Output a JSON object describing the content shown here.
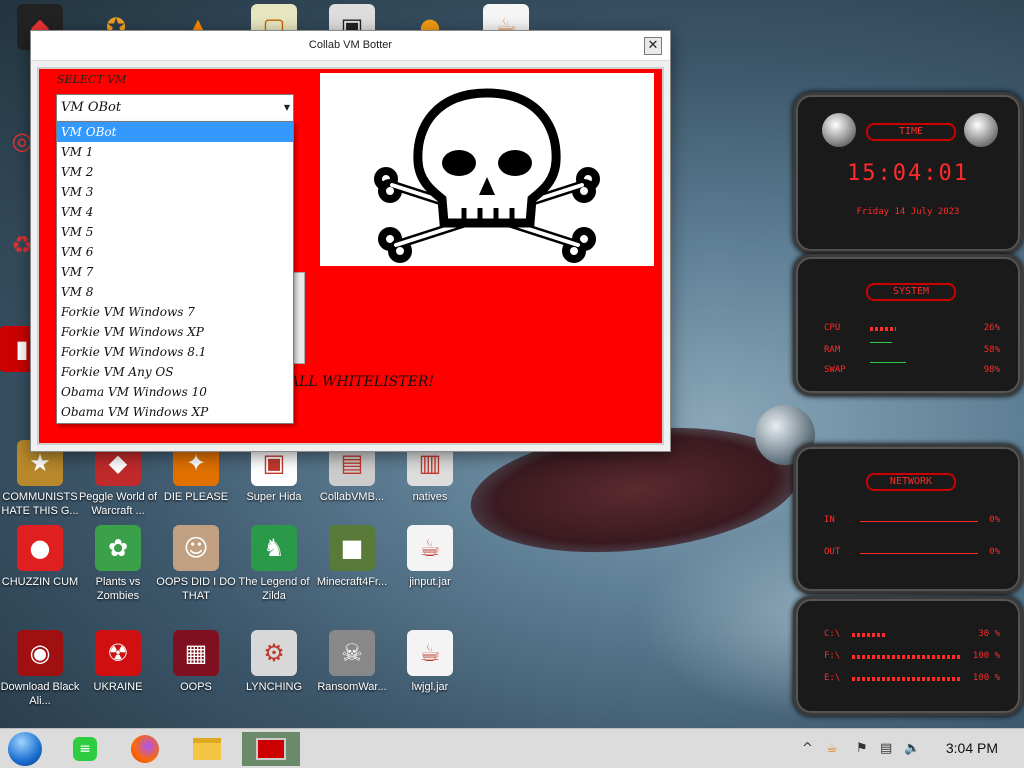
{
  "window": {
    "title": "Collab VM Botter",
    "close_glyph": "✕",
    "select_label": "SELECT VM",
    "selected_vm": "VM OBot",
    "vm_options": [
      "VM OBot",
      "VM 1",
      "VM 2",
      "VM 3",
      "VM 4",
      "VM 5",
      "VM 6",
      "VM 7",
      "VM 8",
      "Forkie VM Windows 7",
      "Forkie VM Windows XP",
      "Forkie VM Windows 8.1",
      "Forkie VM Any OS",
      "Obama VM Windows 10",
      "Obama VM Windows XP"
    ],
    "whitelister_text": "ALL WHITELISTER!",
    "skull_icon": "skull-and-crossbones-icon"
  },
  "desktop_icons": [
    {
      "label": "COMMUNISTS HATE THIS G...",
      "color": "#b8892b",
      "glyph": "★"
    },
    {
      "label": "Peggle World of Warcraft ...",
      "color": "#c02a2a",
      "glyph": "◆"
    },
    {
      "label": "DIE PLEASE",
      "color": "#e07000",
      "glyph": "✦"
    },
    {
      "label": "Super Hida",
      "color": "#ffffff",
      "glyph": "▣"
    },
    {
      "label": "CollabVMB...",
      "color": "#cccccc",
      "glyph": "▤"
    },
    {
      "label": "natives",
      "color": "#dddddd",
      "glyph": "▥"
    },
    {
      "label": "CHUZZIN CUM",
      "color": "#e02020",
      "glyph": "●"
    },
    {
      "label": "Plants vs Zombies",
      "color": "#3aa04a",
      "glyph": "✿"
    },
    {
      "label": "OOPS DID I DO THAT",
      "color": "#c0a080",
      "glyph": "☺"
    },
    {
      "label": "The Legend of Zilda",
      "color": "#2a9a4a",
      "glyph": "♞"
    },
    {
      "label": "Minecraft4Fr...",
      "color": "#5a7a3a",
      "glyph": "■"
    },
    {
      "label": "jinput.jar",
      "color": "#f4f4f4",
      "glyph": "☕"
    },
    {
      "label": "Download Black Ali...",
      "color": "#a01010",
      "glyph": "◉"
    },
    {
      "label": "UKRAINE",
      "color": "#d01010",
      "glyph": "☢"
    },
    {
      "label": "OOPS",
      "color": "#801020",
      "glyph": "▦"
    },
    {
      "label": "LYNCHING",
      "color": "#d8d8d8",
      "glyph": "⚙"
    },
    {
      "label": "RansomWar...",
      "color": "#888888",
      "glyph": "☠"
    },
    {
      "label": "lwjgl.jar",
      "color": "#f4f4f4",
      "glyph": "☕"
    }
  ],
  "gadgets": {
    "time": {
      "header": "TIME",
      "clock": "15:04:01",
      "date": "Friday 14 July 2023"
    },
    "system": {
      "header": "SYSTEM",
      "rows": [
        {
          "label": "CPU",
          "value": "26%"
        },
        {
          "label": "RAM",
          "value": "58%"
        },
        {
          "label": "SWAP",
          "value": "98%"
        }
      ]
    },
    "network": {
      "header": "NETWORK",
      "rows": [
        {
          "label": "IN",
          "value": "0%"
        },
        {
          "label": "OUT",
          "value": "0%"
        }
      ]
    },
    "drives": {
      "rows": [
        {
          "label": "C:\\",
          "value": "30 %"
        },
        {
          "label": "F:\\",
          "value": "100 %"
        },
        {
          "label": "E:\\",
          "value": "100 %"
        }
      ]
    }
  },
  "taskbar": {
    "clock": "3:04 PM"
  },
  "colors": {
    "accent_red": "#ff0000",
    "selection_blue": "#3399ff",
    "gadget_red": "#ff2a2a"
  }
}
